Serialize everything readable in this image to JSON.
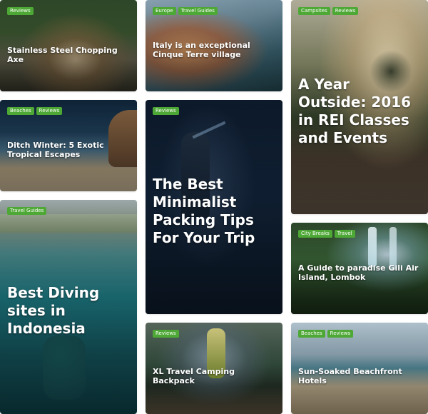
{
  "cards": [
    {
      "title": "Stainless Steel Chopping Axe",
      "tags": [
        "Reviews"
      ]
    },
    {
      "title": "Italy is an exceptional Cinque Terre village",
      "tags": [
        "Europe",
        "Travel Guides"
      ]
    },
    {
      "title": "A Year Outside: 2016 in REI Classes and Events",
      "tags": [
        "Campsites",
        "Reviews"
      ]
    },
    {
      "title": "Ditch Winter: 5 Exotic Tropical Escapes",
      "tags": [
        "Beaches",
        "Reviews"
      ]
    },
    {
      "title": "The Best Minimalist Packing Tips For Your Trip",
      "tags": [
        "Reviews"
      ]
    },
    {
      "title": "A Guide to paradise Gili Air Island, Lombok",
      "tags": [
        "City Breaks",
        "Travel"
      ]
    },
    {
      "title": "Best Diving sites in Indonesia",
      "tags": [
        "Travel Guides"
      ]
    },
    {
      "title": "XL Travel Camping Backpack",
      "tags": [
        "Reviews"
      ]
    },
    {
      "title": "Sun-Soaked Beachfront Hotels",
      "tags": [
        "Beaches",
        "Reviews"
      ]
    }
  ],
  "colors": {
    "tag": "#4ea836",
    "text": "#ffffff",
    "page": "#ffffff"
  }
}
